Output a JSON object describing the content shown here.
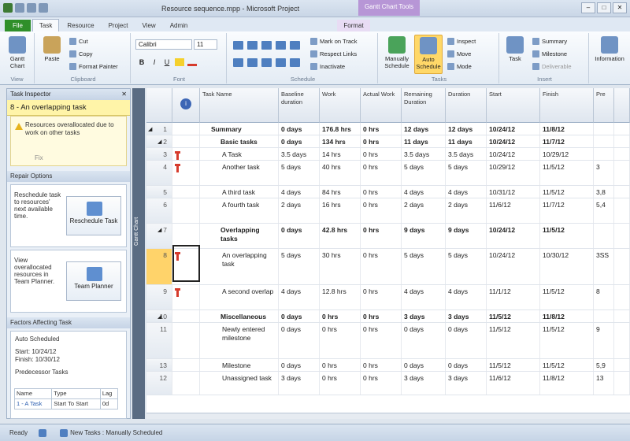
{
  "app": {
    "window_title": "Resource sequence.mpp - Microsoft Project",
    "context_tab": "Gantt Chart Tools"
  },
  "ribbon_tabs": [
    "File",
    "Task",
    "Resource",
    "Project",
    "View",
    "Admin",
    "Format"
  ],
  "ribbon": {
    "view_group": {
      "gantt_chart": "Gantt Chart",
      "label": "View"
    },
    "clipboard": {
      "paste": "Paste",
      "cut": "Cut",
      "copy": "Copy",
      "format_painter": "Format Painter",
      "label": "Clipboard"
    },
    "font": {
      "name": "Calibri",
      "size": "11",
      "bold": "B",
      "italic": "I",
      "underline": "U",
      "label": "Font"
    },
    "schedule": {
      "mark_on_track": "Mark on Track",
      "respect_links": "Respect Links",
      "inactivate": "Inactivate",
      "label": "Schedule"
    },
    "tasks": {
      "manually_schedule": "Manually Schedule",
      "auto_schedule": "Auto Schedule",
      "inspect": "Inspect",
      "move": "Move",
      "mode": "Mode",
      "label": "Tasks"
    },
    "insert": {
      "task": "Task",
      "summary": "Summary",
      "milestone": "Milestone",
      "deliverable": "Deliverable",
      "label": "Insert"
    },
    "properties": {
      "information": "Information"
    }
  },
  "inspector": {
    "header": "Task Inspector",
    "task": "8 - An overlapping task",
    "warning": "Resources overallocated due to work on other tasks",
    "fix": "Fix",
    "repair_header": "Repair Options",
    "reschedule_text": "Reschedule task to resources' next available time.",
    "reschedule_button": "Reschedule Task",
    "planner_text": "View overallocated resources in Team Planner.",
    "planner_button": "Team Planner",
    "factors_header": "Factors Affecting Task",
    "auto_scheduled": "Auto Scheduled",
    "start": "Start: 10/24/12",
    "finish": "Finish: 10/30/12",
    "predecessor_tasks": "Predecessor Tasks",
    "pred_columns": [
      "Name",
      "Type",
      "Lag"
    ],
    "pred_row": [
      "1 - A Task",
      "Start To Start",
      "0d"
    ]
  },
  "gantt_side_label": "Gantt Chart",
  "table": {
    "columns": [
      "",
      "Task Name",
      "Baseline duration",
      "Work",
      "Actual Work",
      "Remaining Duration",
      "Duration",
      "Start",
      "Finish",
      "Pre"
    ],
    "rows": [
      {
        "id": "1",
        "name": "Summary",
        "baseline": "0 days",
        "work": "176.8 hrs",
        "actual": "0 hrs",
        "remaining": "12 days",
        "duration": "12 days",
        "start": "10/24/12",
        "finish": "11/8/12",
        "pred": "",
        "bold": true
      },
      {
        "id": "2",
        "name": "Basic tasks",
        "baseline": "0 days",
        "work": "134 hrs",
        "actual": "0 hrs",
        "remaining": "11 days",
        "duration": "11 days",
        "start": "10/24/12",
        "finish": "11/7/12",
        "pred": "",
        "bold": true
      },
      {
        "id": "3",
        "name": "A Task",
        "baseline": "3.5 days",
        "work": "14 hrs",
        "actual": "0 hrs",
        "remaining": "3.5 days",
        "duration": "3.5 days",
        "start": "10/24/12",
        "finish": "10/29/12",
        "pred": "",
        "bold": false
      },
      {
        "id": "4",
        "name": "Another task",
        "baseline": "5 days",
        "work": "40 hrs",
        "actual": "0 hrs",
        "remaining": "5 days",
        "duration": "5 days",
        "start": "10/29/12",
        "finish": "11/5/12",
        "pred": "3",
        "bold": false
      },
      {
        "id": "5",
        "name": "A third task",
        "baseline": "4 days",
        "work": "84 hrs",
        "actual": "0 hrs",
        "remaining": "4 days",
        "duration": "4 days",
        "start": "10/31/12",
        "finish": "11/5/12",
        "pred": "3,8",
        "bold": false
      },
      {
        "id": "6",
        "name": "A fourth task",
        "baseline": "2 days",
        "work": "16 hrs",
        "actual": "0 hrs",
        "remaining": "2 days",
        "duration": "2 days",
        "start": "11/6/12",
        "finish": "11/7/12",
        "pred": "5,4",
        "bold": false
      },
      {
        "id": "7",
        "name": "Overlapping tasks",
        "baseline": "0 days",
        "work": "42.8 hrs",
        "actual": "0 hrs",
        "remaining": "9 days",
        "duration": "9 days",
        "start": "10/24/12",
        "finish": "11/5/12",
        "pred": "",
        "bold": true
      },
      {
        "id": "8",
        "name": "An overlapping task",
        "baseline": "5 days",
        "work": "30 hrs",
        "actual": "0 hrs",
        "remaining": "5 days",
        "duration": "5 days",
        "start": "10/24/12",
        "finish": "10/30/12",
        "pred": "3SS",
        "bold": false
      },
      {
        "id": "9",
        "name": "A second overlap",
        "baseline": "4 days",
        "work": "12.8 hrs",
        "actual": "0 hrs",
        "remaining": "4 days",
        "duration": "4 days",
        "start": "11/1/12",
        "finish": "11/5/12",
        "pred": "8",
        "bold": false
      },
      {
        "id": "10",
        "name": "Miscellaneous tasks",
        "baseline": "0 days",
        "work": "0 hrs",
        "actual": "0 hrs",
        "remaining": "3 days",
        "duration": "3 days",
        "start": "11/5/12",
        "finish": "11/8/12",
        "pred": "",
        "bold": true
      },
      {
        "id": "11",
        "name": "Newly entered milestone",
        "baseline": "0 days",
        "work": "0 hrs",
        "actual": "0 hrs",
        "remaining": "0 days",
        "duration": "0 days",
        "start": "11/5/12",
        "finish": "11/5/12",
        "pred": "9",
        "bold": false
      },
      {
        "id": "13",
        "name": "Milestone",
        "baseline": "0 days",
        "work": "0 hrs",
        "actual": "0 hrs",
        "remaining": "0 days",
        "duration": "0 days",
        "start": "11/5/12",
        "finish": "11/5/12",
        "pred": "5,9",
        "bold": false
      },
      {
        "id": "12",
        "name": "Unassigned task",
        "baseline": "3 days",
        "work": "0 hrs",
        "actual": "0 hrs",
        "remaining": "3 days",
        "duration": "3 days",
        "start": "11/6/12",
        "finish": "11/8/12",
        "pred": "13",
        "bold": false
      }
    ]
  },
  "status": {
    "ready": "Ready",
    "new_tasks": "New Tasks : Manually Scheduled"
  },
  "colors": {
    "accent": "#2f8f2a",
    "selected_row": "#ffd36a",
    "indicator": "#d63b2c",
    "inspector_task": "#fff4a8"
  }
}
